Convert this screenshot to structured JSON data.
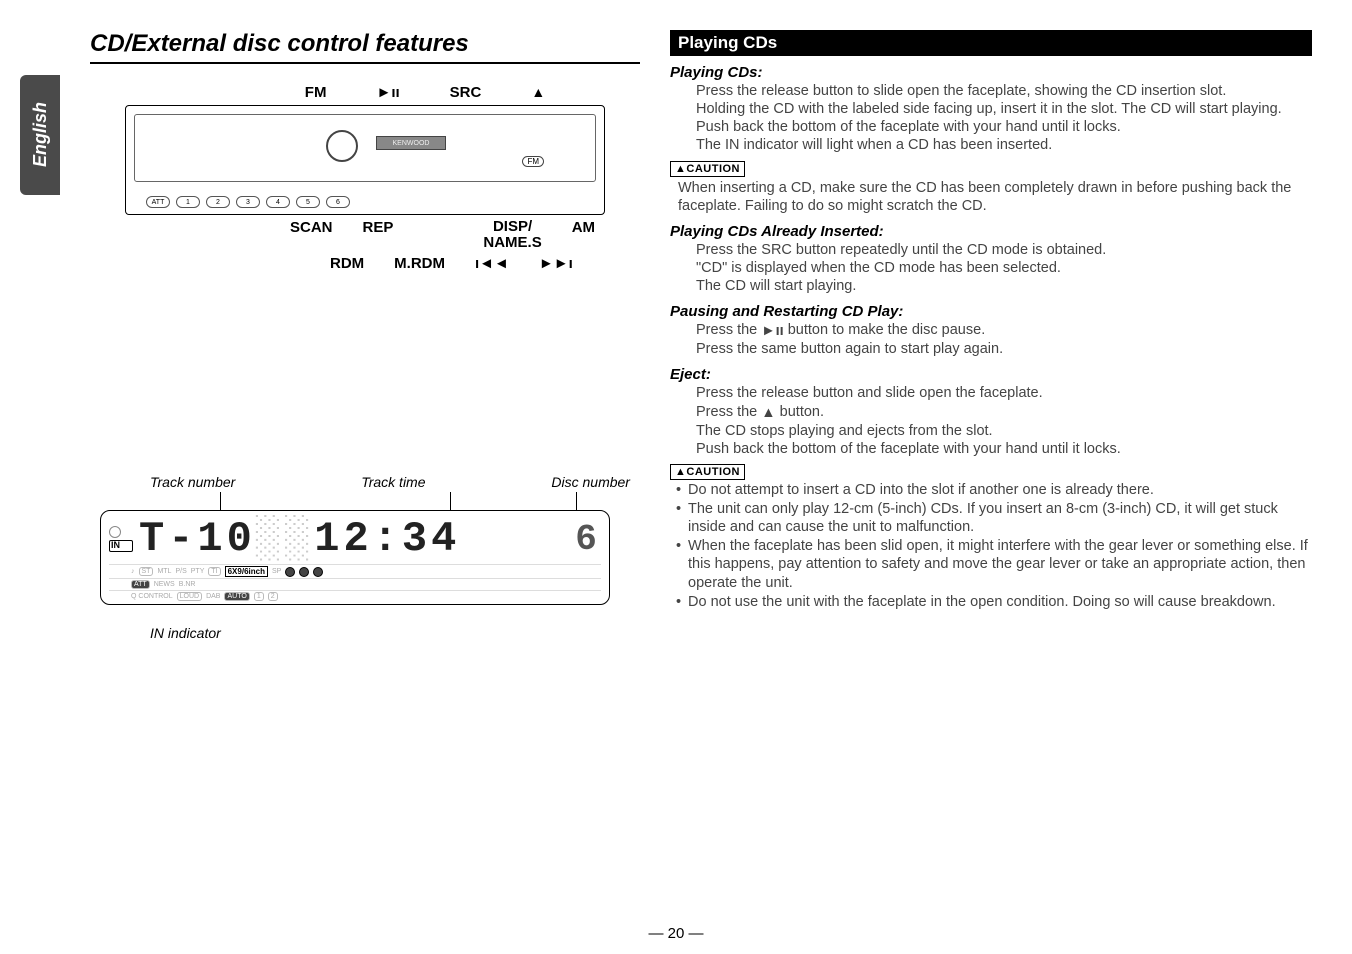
{
  "side_tab": "English",
  "page_title": "CD/External disc control features",
  "device": {
    "top_labels": {
      "fm": "FM",
      "play": "►ıı",
      "src": "SRC",
      "eject": "▲"
    },
    "brand": "KENWOOD",
    "fm_pill": "FM",
    "num_buttons": [
      "ATT",
      "1",
      "2",
      "3",
      "4",
      "5",
      "6"
    ],
    "bottom_row1": {
      "scan": "SCAN",
      "rep": "REP",
      "disp1": "DISP/",
      "disp2": "NAME.S",
      "am": "AM"
    },
    "bottom_row2": {
      "rdm": "RDM",
      "mrdm": "M.RDM",
      "prev": "ı◄◄",
      "next": "►►ı"
    }
  },
  "lcd": {
    "labels": {
      "track_no": "Track number",
      "track_time": "Track time",
      "disc_no": "Disc number"
    },
    "in": "IN",
    "main_track": "T-10",
    "main_time": "12:34",
    "disc": "6",
    "status": {
      "st": "ST",
      "mtl": "MTL",
      "ps": "P/S",
      "pty": "PTY",
      "ti": "TI",
      "att": "ATT",
      "news": "NEWS",
      "bnr": "B.NR",
      "qcontrol": "Q CONTROL",
      "loud": "LOUD",
      "dab": "DAB",
      "auto": "AUTO",
      "n1": "1",
      "n2": "2",
      "sixnine": "6X9/6inch",
      "sp": "SP"
    },
    "indicator": "IN indicator"
  },
  "right": {
    "section": "Playing CDs",
    "h1": "Playing CDs:",
    "p1a": "Press the release button to slide open the faceplate, showing the CD insertion slot.",
    "p1b": "Holding the CD with the labeled side facing up, insert it in the slot. The CD will start playing. Push back the bottom of the faceplate with your hand until it locks.",
    "p1c": "The IN indicator will light when a CD has been inserted.",
    "caution_label": "▲CAUTION",
    "c1": "When inserting a CD, make sure the CD has been completely drawn in before pushing back the faceplate. Failing to do so might scratch the CD.",
    "h2": "Playing CDs Already Inserted:",
    "p2a": "Press the SRC button repeatedly until the CD mode is obtained.",
    "p2b": "\"CD\" is displayed when the CD mode has been selected.",
    "p2c": "The CD will start playing.",
    "h3": "Pausing and Restarting CD Play:",
    "p3a_pre": "Press the ",
    "p3a_post": " button to make the disc pause.",
    "p3b": "Press the same button again to start play again.",
    "h4": "Eject:",
    "p4a": "Press the release button and slide open the faceplate.",
    "p4b_pre": "Press the ",
    "p4b_post": " button.",
    "p4c": "The CD stops playing and ejects from the slot.",
    "p4d": "Push back the bottom of the faceplate with your hand until it locks.",
    "bul1": "Do not attempt to insert a CD into the slot if another one is already there.",
    "bul2": "The unit can only play 12-cm (5-inch) CDs. If you insert an 8-cm (3-inch) CD, it will get stuck inside and can cause the unit to malfunction.",
    "bul3": "When the faceplate has been slid open, it might interfere with the gear lever or something else. If this happens, pay attention to safety and move the gear lever or take an appropriate action, then operate the unit.",
    "bul4": "Do not use the unit with the faceplate in the open condition. Doing so will cause breakdown."
  },
  "page_num": "— 20 —"
}
